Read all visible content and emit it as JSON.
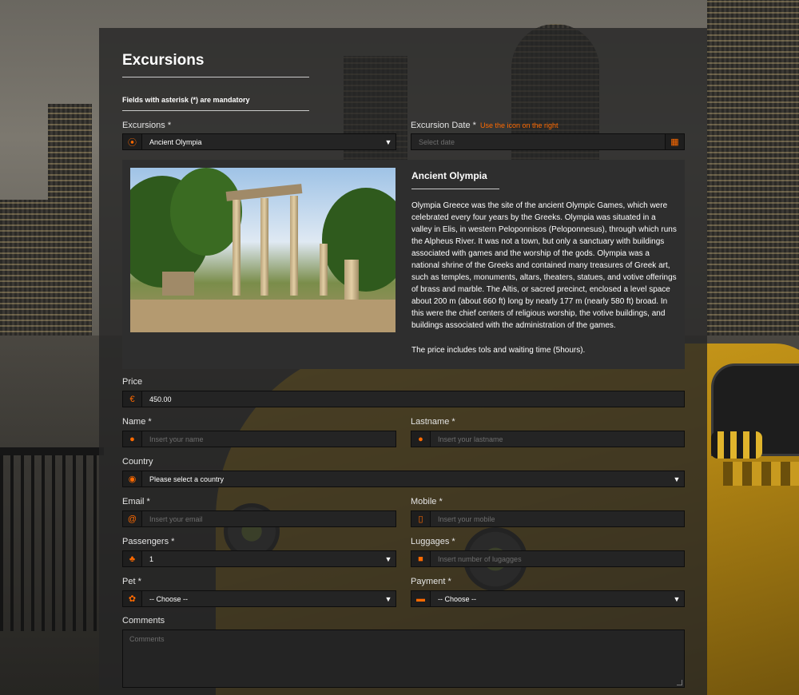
{
  "page": {
    "title": "Excursions",
    "mandatory_note": "Fields with asterisk (*) are mandatory"
  },
  "excursion": {
    "label": "Excursions *",
    "selected": "Ancient Olympia",
    "icon": "map-pin-icon"
  },
  "excursion_date": {
    "label": "Excursion Date *",
    "hint": "Use the icon on the right",
    "placeholder": "Select date",
    "icon": "calendar-icon"
  },
  "info": {
    "title": "Ancient Olympia",
    "description": "Olympia Greece was the site of the ancient Olympic Games, which were celebrated every four years by the Greeks. Olympia was situated in a valley in Elis, in western Peloponnisos (Peloponnesus), through which runs the Alpheus River. It was not a town, but only a sanctuary with buildings associated with games and the worship of the gods. Olympia was a national shrine of the Greeks and contained many treasures of Greek art, such as temples, monuments, altars, theaters, statues, and votive offerings of brass and marble. The Altis, or sacred precinct, enclosed a level space about 200 m (about 660 ft) long by nearly 177 m (nearly 580 ft) broad. In this were the chief centers of religious worship, the votive buildings, and buildings associated with the administration of the games.",
    "price_note": "The price includes tols and waiting time (5hours)."
  },
  "price": {
    "label": "Price",
    "value": "450.00",
    "icon": "euro-icon"
  },
  "name": {
    "label": "Name *",
    "placeholder": "Insert your name",
    "icon": "user-icon"
  },
  "lastname": {
    "label": "Lastname *",
    "placeholder": "Insert your lastname",
    "icon": "user-icon"
  },
  "country": {
    "label": "Country",
    "selected": "Please select a country",
    "icon": "globe-icon"
  },
  "email": {
    "label": "Email *",
    "placeholder": "Insert your email",
    "icon": "at-icon"
  },
  "mobile": {
    "label": "Mobile *",
    "placeholder": "Insert your mobile",
    "icon": "mobile-icon"
  },
  "passengers": {
    "label": "Passengers *",
    "selected": "1",
    "icon": "group-icon"
  },
  "luggages": {
    "label": "Luggages *",
    "placeholder": "Insert number of lugagges",
    "icon": "suitcase-icon"
  },
  "pet": {
    "label": "Pet *",
    "selected": "-- Choose --",
    "icon": "paw-icon"
  },
  "payment": {
    "label": "Payment *",
    "selected": "-- Choose --",
    "icon": "credit-card-icon"
  },
  "comments": {
    "label": "Comments",
    "placeholder": "Comments"
  },
  "colors": {
    "accent": "#ff6a00",
    "panel": "#262626",
    "field": "#242424"
  },
  "glyphs": {
    "pin": "⦿",
    "calendar": "▦",
    "euro": "€",
    "user": "●",
    "globe": "◉",
    "at": "@",
    "mobile": "▯",
    "group": "♣",
    "suitcase": "■",
    "paw": "✿",
    "card": "▬",
    "caret": "▼"
  }
}
